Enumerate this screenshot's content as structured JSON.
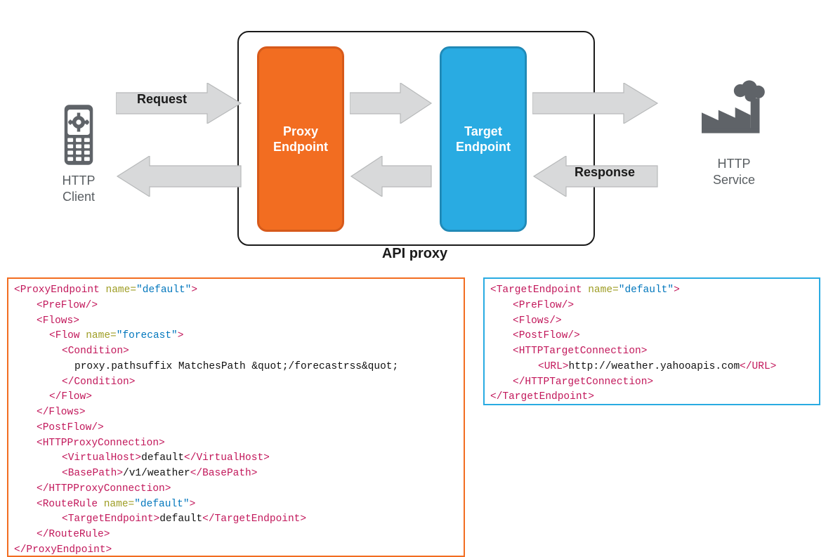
{
  "diagram": {
    "client_label": "HTTP\nClient",
    "service_label": "HTTP\nService",
    "api_box_caption": "API proxy",
    "proxy_node": "Proxy\nEndpoint",
    "target_node": "Target\nEndpoint",
    "request_label": "Request",
    "response_label": "Response"
  },
  "colors": {
    "orange": "#f26d21",
    "blue": "#29abe2",
    "arrow": "#d8d9da",
    "icon": "#5f6368"
  },
  "proxy_code": [
    [
      0,
      [
        {
          "k": "tag",
          "t": "<ProxyEndpoint "
        },
        {
          "k": "attr",
          "t": "name="
        },
        {
          "k": "val",
          "t": "\"default\""
        },
        {
          "k": "tag",
          "t": ">"
        }
      ]
    ],
    [
      1,
      [
        {
          "k": "tag",
          "t": "<PreFlow/>"
        }
      ]
    ],
    [
      1,
      [
        {
          "k": "tag",
          "t": "<Flows>"
        }
      ]
    ],
    [
      2,
      [
        {
          "k": "tag",
          "t": "<Flow "
        },
        {
          "k": "attr",
          "t": "name="
        },
        {
          "k": "val",
          "t": "\"forecast\""
        },
        {
          "k": "tag",
          "t": ">"
        }
      ]
    ],
    [
      3,
      [
        {
          "k": "tag",
          "t": "<Condition>"
        }
      ]
    ],
    [
      4,
      [
        {
          "k": "txt",
          "t": "proxy.pathsuffix MatchesPath &quot;/forecastrss&quot;"
        }
      ]
    ],
    [
      3,
      [
        {
          "k": "tag",
          "t": "</Condition>"
        }
      ]
    ],
    [
      2,
      [
        {
          "k": "tag",
          "t": "</Flow>"
        }
      ]
    ],
    [
      1,
      [
        {
          "k": "tag",
          "t": "</Flows>"
        }
      ]
    ],
    [
      1,
      [
        {
          "k": "tag",
          "t": "<PostFlow/>"
        }
      ]
    ],
    [
      1,
      [
        {
          "k": "tag",
          "t": "<HTTPProxyConnection>"
        }
      ]
    ],
    [
      3,
      [
        {
          "k": "tag",
          "t": "<VirtualHost>"
        },
        {
          "k": "txt",
          "t": "default"
        },
        {
          "k": "tag",
          "t": "</VirtualHost>"
        }
      ]
    ],
    [
      3,
      [
        {
          "k": "tag",
          "t": "<BasePath>"
        },
        {
          "k": "txt",
          "t": "/v1/weather"
        },
        {
          "k": "tag",
          "t": "</BasePath>"
        }
      ]
    ],
    [
      1,
      [
        {
          "k": "tag",
          "t": "</HTTPProxyConnection>"
        }
      ]
    ],
    [
      1,
      [
        {
          "k": "tag",
          "t": "<RouteRule "
        },
        {
          "k": "attr",
          "t": "name="
        },
        {
          "k": "val",
          "t": "\"default\""
        },
        {
          "k": "tag",
          "t": ">"
        }
      ]
    ],
    [
      3,
      [
        {
          "k": "tag",
          "t": "<TargetEndpoint>"
        },
        {
          "k": "txt",
          "t": "default"
        },
        {
          "k": "tag",
          "t": "</TargetEndpoint>"
        }
      ]
    ],
    [
      1,
      [
        {
          "k": "tag",
          "t": "</RouteRule>"
        }
      ]
    ],
    [
      0,
      [
        {
          "k": "tag",
          "t": "</ProxyEndpoint>"
        }
      ]
    ]
  ],
  "target_code": [
    [
      0,
      [
        {
          "k": "tag",
          "t": "<TargetEndpoint "
        },
        {
          "k": "attr",
          "t": "name="
        },
        {
          "k": "val",
          "t": "\"default\""
        },
        {
          "k": "tag",
          "t": ">"
        }
      ]
    ],
    [
      1,
      [
        {
          "k": "tag",
          "t": "<PreFlow/>"
        }
      ]
    ],
    [
      1,
      [
        {
          "k": "tag",
          "t": "<Flows/>"
        }
      ]
    ],
    [
      1,
      [
        {
          "k": "tag",
          "t": "<PostFlow/>"
        }
      ]
    ],
    [
      1,
      [
        {
          "k": "tag",
          "t": "<HTTPTargetConnection>"
        }
      ]
    ],
    [
      3,
      [
        {
          "k": "tag",
          "t": "<URL>"
        },
        {
          "k": "txt",
          "t": "http://weather.yahooapis.com"
        },
        {
          "k": "tag",
          "t": "</URL>"
        }
      ]
    ],
    [
      1,
      [
        {
          "k": "tag",
          "t": "</HTTPTargetConnection>"
        }
      ]
    ],
    [
      0,
      [
        {
          "k": "tag",
          "t": "</TargetEndpoint>"
        }
      ]
    ]
  ]
}
